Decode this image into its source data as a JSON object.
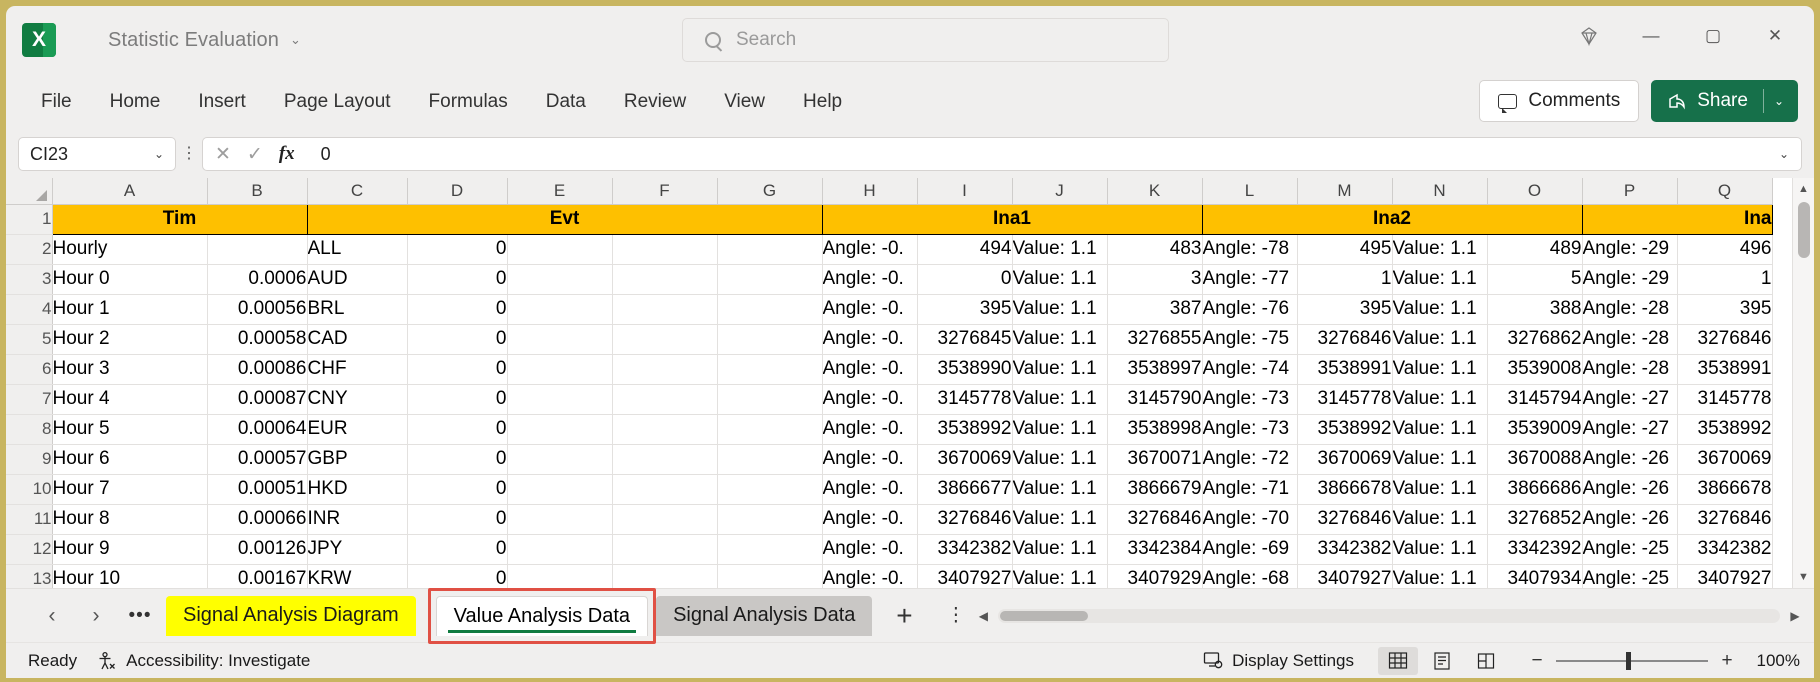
{
  "titlebar": {
    "app_icon": "excel-logo",
    "document_title": "Statistic Evaluation",
    "title_chevron": "⌄",
    "search_placeholder": "Search",
    "diamond_label": "",
    "minimize": "—",
    "maximize": "▢",
    "close": "✕"
  },
  "ribbon": {
    "tabs": [
      "File",
      "Home",
      "Insert",
      "Page Layout",
      "Formulas",
      "Data",
      "Review",
      "View",
      "Help"
    ],
    "comments_label": "Comments",
    "share_label": "Share",
    "share_chevron": "⌄"
  },
  "formula_bar": {
    "name_box_value": "CI23",
    "name_box_chevron": "⌄",
    "cancel": "✕",
    "confirm": "✓",
    "fx": "fx",
    "formula_value": "0",
    "expand_chevron": "⌄"
  },
  "grid": {
    "column_letters": [
      "A",
      "B",
      "C",
      "D",
      "E",
      "F",
      "G",
      "H",
      "I",
      "J",
      "K",
      "L",
      "M",
      "N",
      "O",
      "P",
      "Q"
    ],
    "row_numbers": [
      "1",
      "2",
      "3",
      "4",
      "5",
      "6",
      "7",
      "8",
      "9",
      "10",
      "11",
      "12",
      "13"
    ],
    "banner_row": [
      {
        "label": "Tim",
        "span": 2,
        "align": "center"
      },
      {
        "label": "Evt",
        "span": 5,
        "align": "center"
      },
      {
        "label": "Ina1",
        "span": 4,
        "align": "center"
      },
      {
        "label": "Ina2",
        "span": 4,
        "align": "center"
      },
      {
        "label": "Ina",
        "span": 2,
        "align": "right"
      }
    ],
    "rows": [
      [
        "Hourly",
        "",
        "ALL",
        "0",
        "",
        "",
        "",
        "Angle: -0.",
        "494",
        "Value: 1.1",
        "483",
        "Angle: -78",
        "495",
        "Value: 1.1",
        "489",
        "Angle: -29",
        "496"
      ],
      [
        "Hour 0",
        "0.0006",
        "AUD",
        "0",
        "",
        "",
        "",
        "Angle: -0.",
        "0",
        "Value: 1.1",
        "3",
        "Angle: -77",
        "1",
        "Value: 1.1",
        "5",
        "Angle: -29",
        "1"
      ],
      [
        "Hour 1",
        "0.00056",
        "BRL",
        "0",
        "",
        "",
        "",
        "Angle: -0.",
        "395",
        "Value: 1.1",
        "387",
        "Angle: -76",
        "395",
        "Value: 1.1",
        "388",
        "Angle: -28",
        "395"
      ],
      [
        "Hour 2",
        "0.00058",
        "CAD",
        "0",
        "",
        "",
        "",
        "Angle: -0.",
        "3276845",
        "Value: 1.1",
        "3276855",
        "Angle: -75",
        "3276846",
        "Value: 1.1",
        "3276862",
        "Angle: -28",
        "3276846"
      ],
      [
        "Hour 3",
        "0.00086",
        "CHF",
        "0",
        "",
        "",
        "",
        "Angle: -0.",
        "3538990",
        "Value: 1.1",
        "3538997",
        "Angle: -74",
        "3538991",
        "Value: 1.1",
        "3539008",
        "Angle: -28",
        "3538991"
      ],
      [
        "Hour 4",
        "0.00087",
        "CNY",
        "0",
        "",
        "",
        "",
        "Angle: -0.",
        "3145778",
        "Value: 1.1",
        "3145790",
        "Angle: -73",
        "3145778",
        "Value: 1.1",
        "3145794",
        "Angle: -27",
        "3145778"
      ],
      [
        "Hour 5",
        "0.00064",
        "EUR",
        "0",
        "",
        "",
        "",
        "Angle: -0.",
        "3538992",
        "Value: 1.1",
        "3538998",
        "Angle: -73",
        "3538992",
        "Value: 1.1",
        "3539009",
        "Angle: -27",
        "3538992"
      ],
      [
        "Hour 6",
        "0.00057",
        "GBP",
        "0",
        "",
        "",
        "",
        "Angle: -0.",
        "3670069",
        "Value: 1.1",
        "3670071",
        "Angle: -72",
        "3670069",
        "Value: 1.1",
        "3670088",
        "Angle: -26",
        "3670069"
      ],
      [
        "Hour 7",
        "0.00051",
        "HKD",
        "0",
        "",
        "",
        "",
        "Angle: -0.",
        "3866677",
        "Value: 1.1",
        "3866679",
        "Angle: -71",
        "3866678",
        "Value: 1.1",
        "3866686",
        "Angle: -26",
        "3866678"
      ],
      [
        "Hour 8",
        "0.00066",
        "INR",
        "0",
        "",
        "",
        "",
        "Angle: -0.",
        "3276846",
        "Value: 1.1",
        "3276846",
        "Angle: -70",
        "3276846",
        "Value: 1.1",
        "3276852",
        "Angle: -26",
        "3276846"
      ],
      [
        "Hour 9",
        "0.00126",
        "JPY",
        "0",
        "",
        "",
        "",
        "Angle: -0.",
        "3342382",
        "Value: 1.1",
        "3342384",
        "Angle: -69",
        "3342382",
        "Value: 1.1",
        "3342392",
        "Angle: -25",
        "3342382"
      ],
      [
        "Hour 10",
        "0.00167",
        "KRW",
        "0",
        "",
        "",
        "",
        "Angle: -0.",
        "3407927",
        "Value: 1.1",
        "3407929",
        "Angle: -68",
        "3407927",
        "Value: 1.1",
        "3407934",
        "Angle: -25",
        "3407927"
      ]
    ],
    "header_fill": "#FEC000",
    "scroll_up_arrow": "▲",
    "scroll_down_arrow": "▼"
  },
  "sheet_tabs": {
    "prev_label": "‹",
    "next_label": "›",
    "all_sheets_label": "•••",
    "tabs": [
      {
        "name": "Signal Analysis Diagram",
        "state": "highlighted"
      },
      {
        "name": "Value Analysis Data",
        "state": "active"
      },
      {
        "name": "Signal Analysis Data",
        "state": "inactive"
      }
    ],
    "add_sheet_label": "+",
    "tab_menu_label": "⋮",
    "hscroll_left": "◀",
    "hscroll_right": "▶",
    "selection_highlight_color": "#E05044",
    "highlight_color": "#FFFF00"
  },
  "status_bar": {
    "state": "Ready",
    "accessibility": "Accessibility: Investigate",
    "display_settings": "Display Settings",
    "view_normal": "normal-view-icon",
    "view_page_layout": "page-layout-view-icon",
    "view_page_break": "page-break-view-icon",
    "zoom_out": "−",
    "zoom_in": "+",
    "zoom_level": "100%"
  }
}
